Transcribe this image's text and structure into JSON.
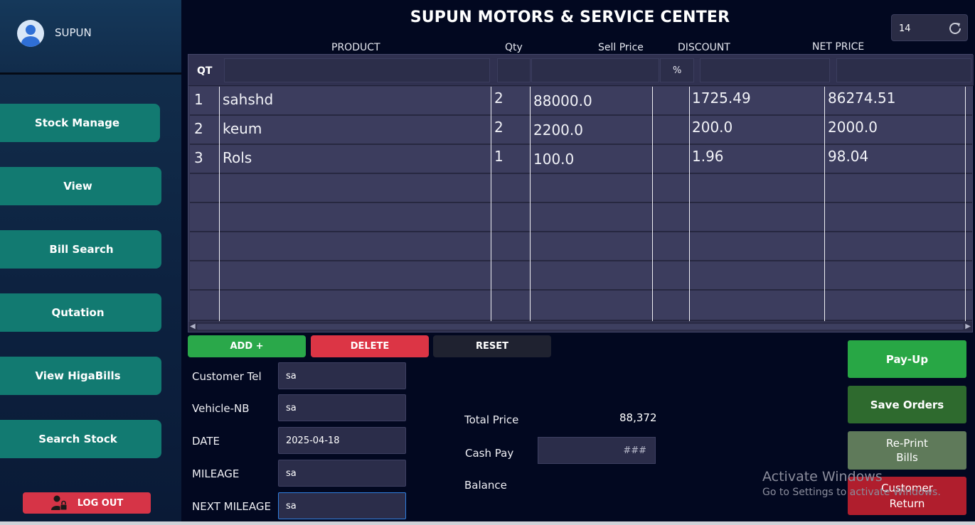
{
  "user": {
    "name": "SUPUN"
  },
  "nav": [
    {
      "label": "Stock Manage"
    },
    {
      "label": "View"
    },
    {
      "label": "Bill Search"
    },
    {
      "label": "Qutation"
    },
    {
      "label": "View HigaBills"
    },
    {
      "label": "Search Stock"
    }
  ],
  "logout_label": "LOG OUT",
  "title": "SUPUN MOTORS & SERVICE CENTER",
  "counter_value": "14",
  "columns": {
    "product": "PRODUCT",
    "qty": "Qty",
    "sell_price": "Sell Price",
    "discount": "DISCOUNT",
    "net_price": "NET PRICE"
  },
  "input_row": {
    "qt_label": "QT",
    "percent_label": "%"
  },
  "rows": [
    {
      "no": "1",
      "product": "sahshd",
      "qty": "2",
      "sell_price": "88000.0",
      "pct": "",
      "discount": "1725.49",
      "net_price": "86274.51"
    },
    {
      "no": "2",
      "product": "keum",
      "qty": "2",
      "sell_price": "2200.0",
      "pct": "",
      "discount": "200.0",
      "net_price": "2000.0"
    },
    {
      "no": "3",
      "product": "Rols",
      "qty": "1",
      "sell_price": "100.0",
      "pct": "",
      "discount": "1.96",
      "net_price": "98.04"
    }
  ],
  "actions": {
    "add": "ADD +",
    "delete": "DELETE",
    "reset": "RESET"
  },
  "form": {
    "customer_tel": {
      "label": "Customer Tel",
      "value": "sa"
    },
    "vehicle_nb": {
      "label": "Vehicle-NB",
      "value": "sa"
    },
    "date": {
      "label": "DATE",
      "value": "2025-04-18"
    },
    "mileage": {
      "label": "MILEAGE",
      "value": "sa"
    },
    "next_mileage": {
      "label": "NEXT MILEAGE",
      "value": "sa"
    }
  },
  "summary": {
    "total_label": "Total Price",
    "total_value": "88,372",
    "cash_label": "Cash Pay",
    "cash_placeholder": "###",
    "balance_label": "Balance"
  },
  "side_buttons": {
    "pay_up": "Pay-Up",
    "save_orders": "Save Orders",
    "reprint_line1": "Re-Print",
    "reprint_line2": "Bills",
    "customer_return_line1": "Customer",
    "customer_return_line2": "Return"
  },
  "watermark": {
    "line1": "Activate Windows",
    "line2": "Go to Settings to activate Windows."
  },
  "colors": {
    "background": "#020820",
    "nav_button": "#127a71",
    "add": "#2aa84a",
    "delete": "#dc3545",
    "reset": "#1f2230",
    "pay_up": "#28a745",
    "save_orders": "#2e6a2e",
    "reprint": "#5f7a5a",
    "customer_return": "#b01e2d"
  }
}
